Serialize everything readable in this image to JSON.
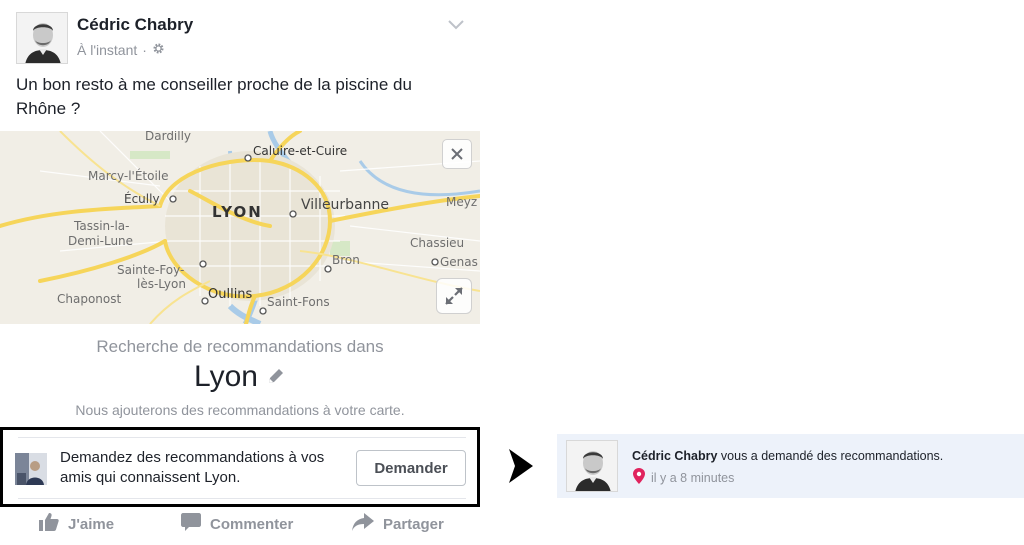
{
  "post": {
    "author": "Cédric Chabry",
    "timestamp": "À l'instant",
    "separator": "·",
    "privacy_icon": "gear-icon",
    "text": "Un bon resto à me conseiller proche de la piscine du Rhône ?"
  },
  "map": {
    "labels": {
      "dardilly": "Dardilly",
      "caluire": "Caluire-et-Cuire",
      "marcy": "Marcy-l'Étoile",
      "ecully": "Écully",
      "lyon": "LYON",
      "villeurbanne": "Villeurbanne",
      "meyzieu": "Meyz",
      "tassin": "Tassin-la-",
      "demilune": "Demi-Lune",
      "chassieu": "Chassieu",
      "bron": "Bron",
      "genas": "Genas",
      "saintefoy1": "Sainte-Foy-",
      "saintefoy2": "lès-Lyon",
      "chaponost": "Chaponost",
      "oullins": "Oullins",
      "saintfons": "Saint-Fons"
    },
    "close_icon": "close-icon",
    "expand_icon": "expand-icon"
  },
  "recommendations": {
    "title": "Recherche de recommandations dans",
    "city": "Lyon",
    "note": "Nous ajouterons des recommandations à votre carte.",
    "ask_text": "Demandez des recommandations à vos amis qui connaissent Lyon.",
    "ask_button": "Demander"
  },
  "actions": {
    "like": "J'aime",
    "comment": "Commenter",
    "share": "Partager"
  },
  "notification": {
    "name": "Cédric Chabry",
    "message": " vous a demandé des recommandations.",
    "time": "il y a 8 minutes"
  },
  "colors": {
    "accent_pin": "#e0245e",
    "notif_bg": "#edf2fa",
    "muted_text": "#90949c"
  }
}
